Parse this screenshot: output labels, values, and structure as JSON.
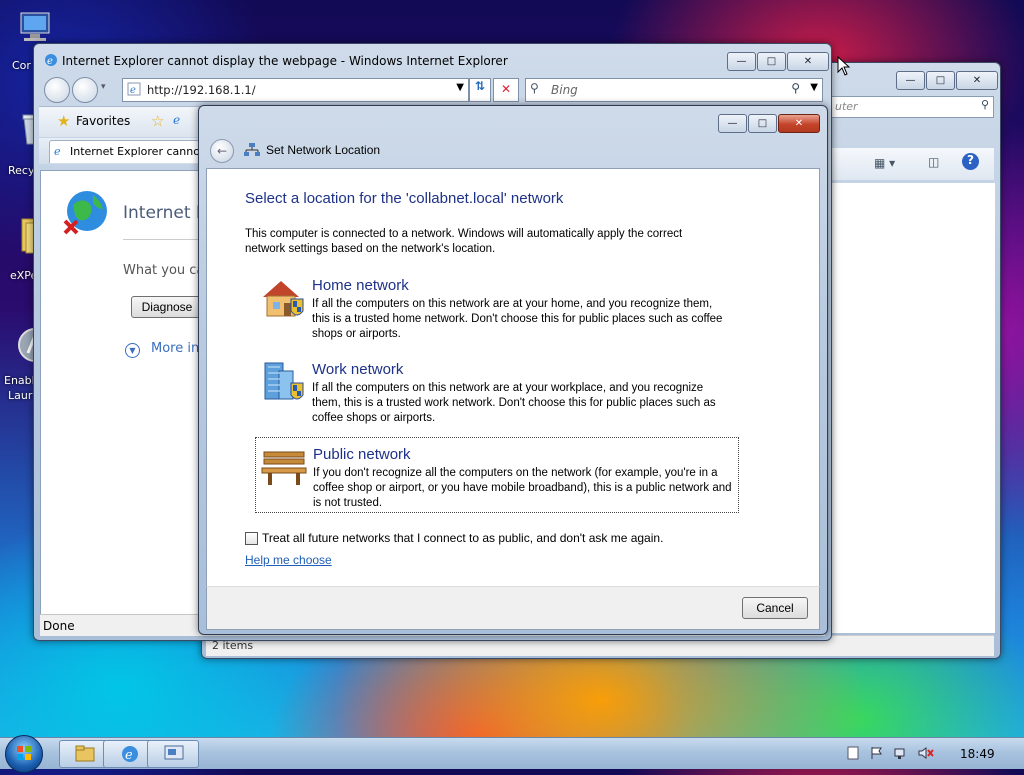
{
  "desktop": {
    "icons": [
      {
        "label": "Cor",
        "icon": "computer-icon"
      },
      {
        "label": "Recy",
        "icon": "recycle-bin-icon"
      },
      {
        "label": "eXPe",
        "icon": "folder-icon"
      },
      {
        "label": "Enabl",
        "label2": "Laur",
        "icon": "launcher-icon"
      }
    ]
  },
  "explorer_window": {
    "search_placeholder": "uter",
    "status": "2 items"
  },
  "ie_window": {
    "title": "Internet Explorer cannot display the webpage - Windows Internet Explorer",
    "address": "http://192.168.1.1/",
    "search_placeholder": "Bing",
    "favorites_label": "Favorites",
    "tab_label": "Internet Explorer cannot",
    "content": {
      "heading": "Internet E",
      "question": "What you ca",
      "diagnose_button": "Diagnose",
      "more_info": "More in"
    },
    "status": "Done"
  },
  "dialog": {
    "title": "Set Network Location",
    "heading": "Select a location for the 'collabnet.local' network",
    "intro": "This computer is connected to a network. Windows will automatically apply the correct network settings based on the network's location.",
    "options": [
      {
        "title": "Home network",
        "description": "If all the computers on this network are at your home, and you recognize them, this is a trusted home network.  Don't choose this for public places such as coffee shops or airports.",
        "icon": "home-network-icon"
      },
      {
        "title": "Work network",
        "description": "If all the computers on this network are at your workplace, and you recognize them, this is a trusted work network.  Don't choose this for public places such as coffee shops or airports.",
        "icon": "work-network-icon"
      },
      {
        "title": "Public network",
        "description": "If you don't recognize all the computers on the network (for example, you're in a coffee shop or airport, or you have mobile broadband), this is a public network and is not trusted.",
        "icon": "public-network-icon"
      }
    ],
    "checkbox_label": "Treat all future networks that I connect to as public, and don't ask me again.",
    "help_link": "Help me choose",
    "cancel_button": "Cancel"
  },
  "taskbar": {
    "clock": "18:49",
    "items": [
      "explorer-icon",
      "internet-explorer-icon",
      "network-dialog-icon"
    ]
  },
  "colors": {
    "dialog_heading": "#1e3287",
    "link": "#1f5fb7",
    "close_red": "#c5442a"
  }
}
